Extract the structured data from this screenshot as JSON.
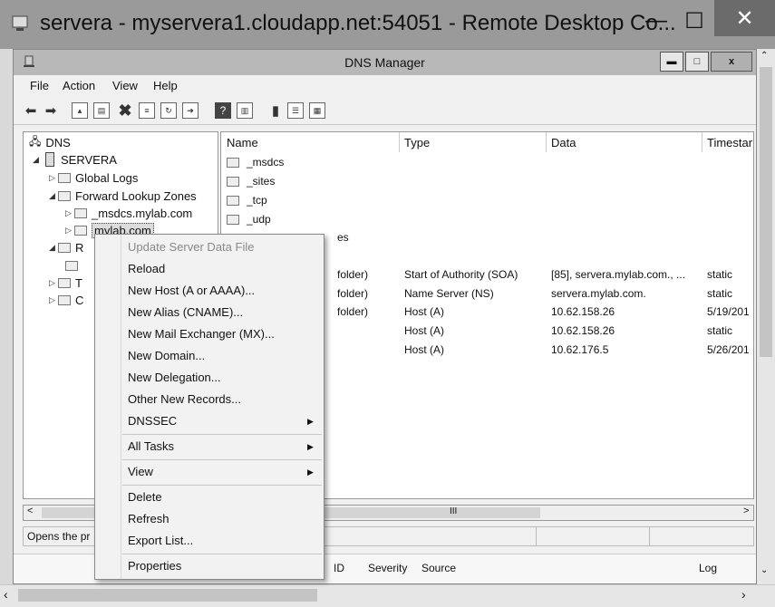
{
  "remote_desktop": {
    "title": "servera - myservera1.cloudapp.net:54051 - Remote Desktop Co...",
    "minimize": "—",
    "maximize": "☐",
    "close": "✕"
  },
  "dns_window": {
    "title": "DNS Manager",
    "minimize": "▬",
    "maximize": "□",
    "close": "x"
  },
  "menu": [
    "File",
    "Action",
    "View",
    "Help"
  ],
  "tree": {
    "root": "DNS",
    "server": "SERVERA",
    "global_logs": "Global Logs",
    "forward_zones": "Forward Lookup Zones",
    "msdcs_zone": "_msdcs.mylab.com",
    "mylab_zone": "mylab.com",
    "reverse_partial": "R",
    "trust_partial": "T",
    "cond_partial": "C"
  },
  "list": {
    "columns": [
      "Name",
      "Type",
      "Data",
      "Timestar"
    ],
    "folder_rows": [
      "_msdcs",
      "_sites",
      "_tcp",
      "_udp"
    ],
    "partial_row_name": "es",
    "records": [
      {
        "name": "folder)",
        "type": "Start of Authority (SOA)",
        "data": "[85], servera.mylab.com., ...",
        "timestamp": "static"
      },
      {
        "name": "folder)",
        "type": "Name Server (NS)",
        "data": "servera.mylab.com.",
        "timestamp": "static"
      },
      {
        "name": "folder)",
        "type": "Host (A)",
        "data": "10.62.158.26",
        "timestamp": "5/19/201"
      },
      {
        "name": "",
        "type": "Host (A)",
        "data": "10.62.158.26",
        "timestamp": "static"
      },
      {
        "name": "",
        "type": "Host (A)",
        "data": "10.62.176.5",
        "timestamp": "5/26/201"
      }
    ]
  },
  "context_menu": {
    "items": [
      "Update Server Data File",
      "Reload",
      "New Host (A or AAAA)...",
      "New Alias (CNAME)...",
      "New Mail Exchanger (MX)...",
      "New Domain...",
      "New Delegation...",
      "Other New Records...",
      "DNSSEC",
      "All Tasks",
      "View",
      "Delete",
      "Refresh",
      "Export List...",
      "Properties"
    ],
    "submenu_arrow": "▶"
  },
  "status": {
    "text": "Opens the pr",
    "hscroll_mark": "III"
  },
  "event_log": {
    "columns": [
      "ID",
      "Severity",
      "Source",
      "Log"
    ]
  },
  "icons": {
    "back": "back-arrow-icon",
    "forward": "forward-arrow-icon",
    "delete": "delete-x-icon",
    "help": "help-icon"
  }
}
